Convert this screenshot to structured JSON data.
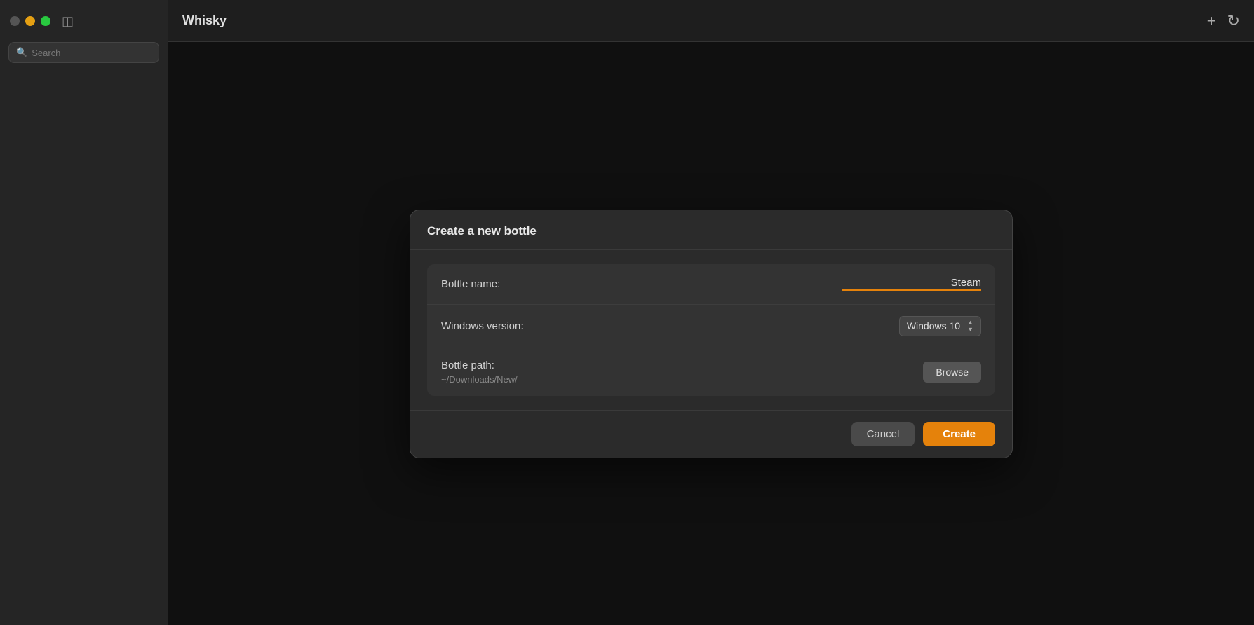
{
  "app": {
    "title": "Whisky"
  },
  "sidebar": {
    "search_placeholder": "Search"
  },
  "header": {
    "add_icon": "+",
    "refresh_icon": "↻"
  },
  "dialog": {
    "title": "Create a new bottle",
    "fields": {
      "bottle_name": {
        "label": "Bottle name:",
        "value": "Steam"
      },
      "windows_version": {
        "label": "Windows version:",
        "value": "Windows 10"
      },
      "bottle_path": {
        "label": "Bottle path:",
        "value": "~/Downloads/New/"
      }
    },
    "browse_label": "Browse",
    "cancel_label": "Cancel",
    "create_label": "Create"
  },
  "colors": {
    "accent": "#e5820b",
    "close": "#555555",
    "minimize": "#e5a013",
    "maximize": "#29c940"
  }
}
